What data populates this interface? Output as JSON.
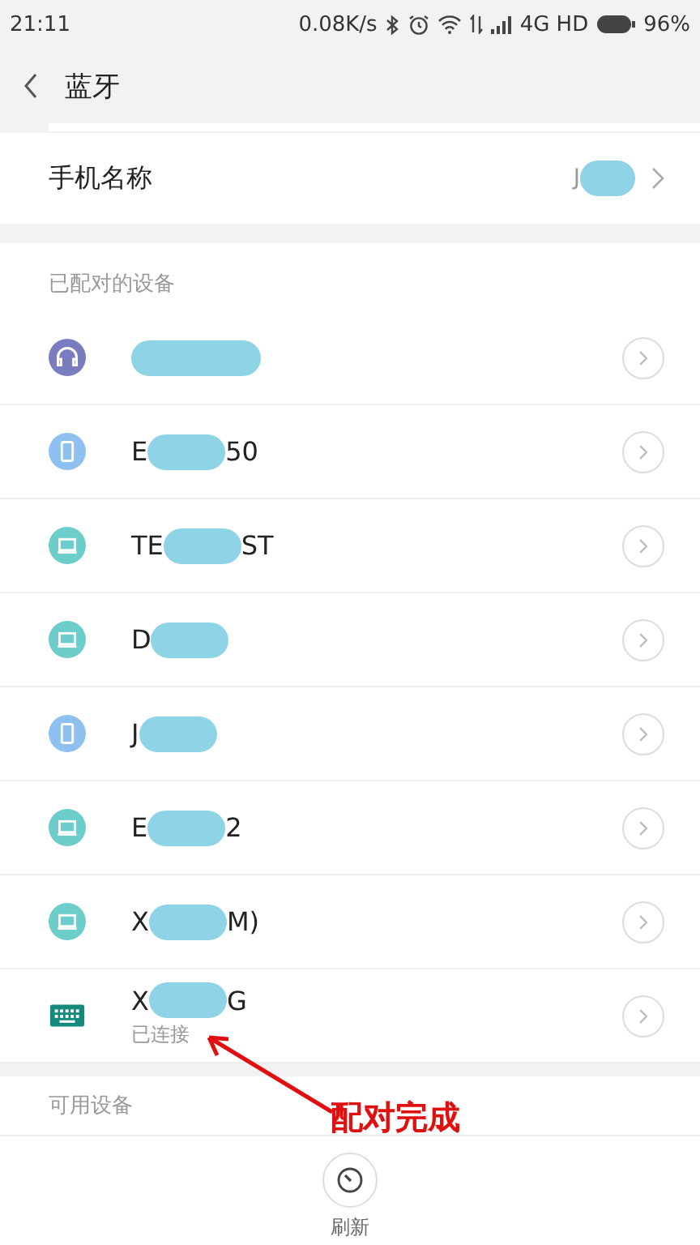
{
  "status_bar": {
    "time": "21:11",
    "speed": "0.08K/s",
    "network": "4G HD",
    "battery": "96%"
  },
  "header": {
    "title": "蓝牙"
  },
  "phone_name": {
    "label": "手机名称",
    "value_start": "J"
  },
  "paired_section": {
    "title": "已配对的设备"
  },
  "paired_devices": [
    {
      "kind": "headset"
    },
    {
      "kind": "phone",
      "name_start": "E",
      "name_end": "50"
    },
    {
      "kind": "laptop",
      "name_start": "TE",
      "name_end": "ST"
    },
    {
      "kind": "laptop",
      "name_start": "D"
    },
    {
      "kind": "phone",
      "name_start": "J"
    },
    {
      "kind": "laptop",
      "name_start": "E",
      "name_end": "2"
    },
    {
      "kind": "laptop",
      "name_start": "X",
      "name_end": "M)"
    },
    {
      "kind": "keyboard",
      "name_start": "X",
      "name_end": "G",
      "status": "已连接"
    }
  ],
  "available_section": {
    "title": "可用设备"
  },
  "bottom_bar": {
    "refresh_label": "刷新"
  },
  "annotation": {
    "text": "配对完成"
  }
}
